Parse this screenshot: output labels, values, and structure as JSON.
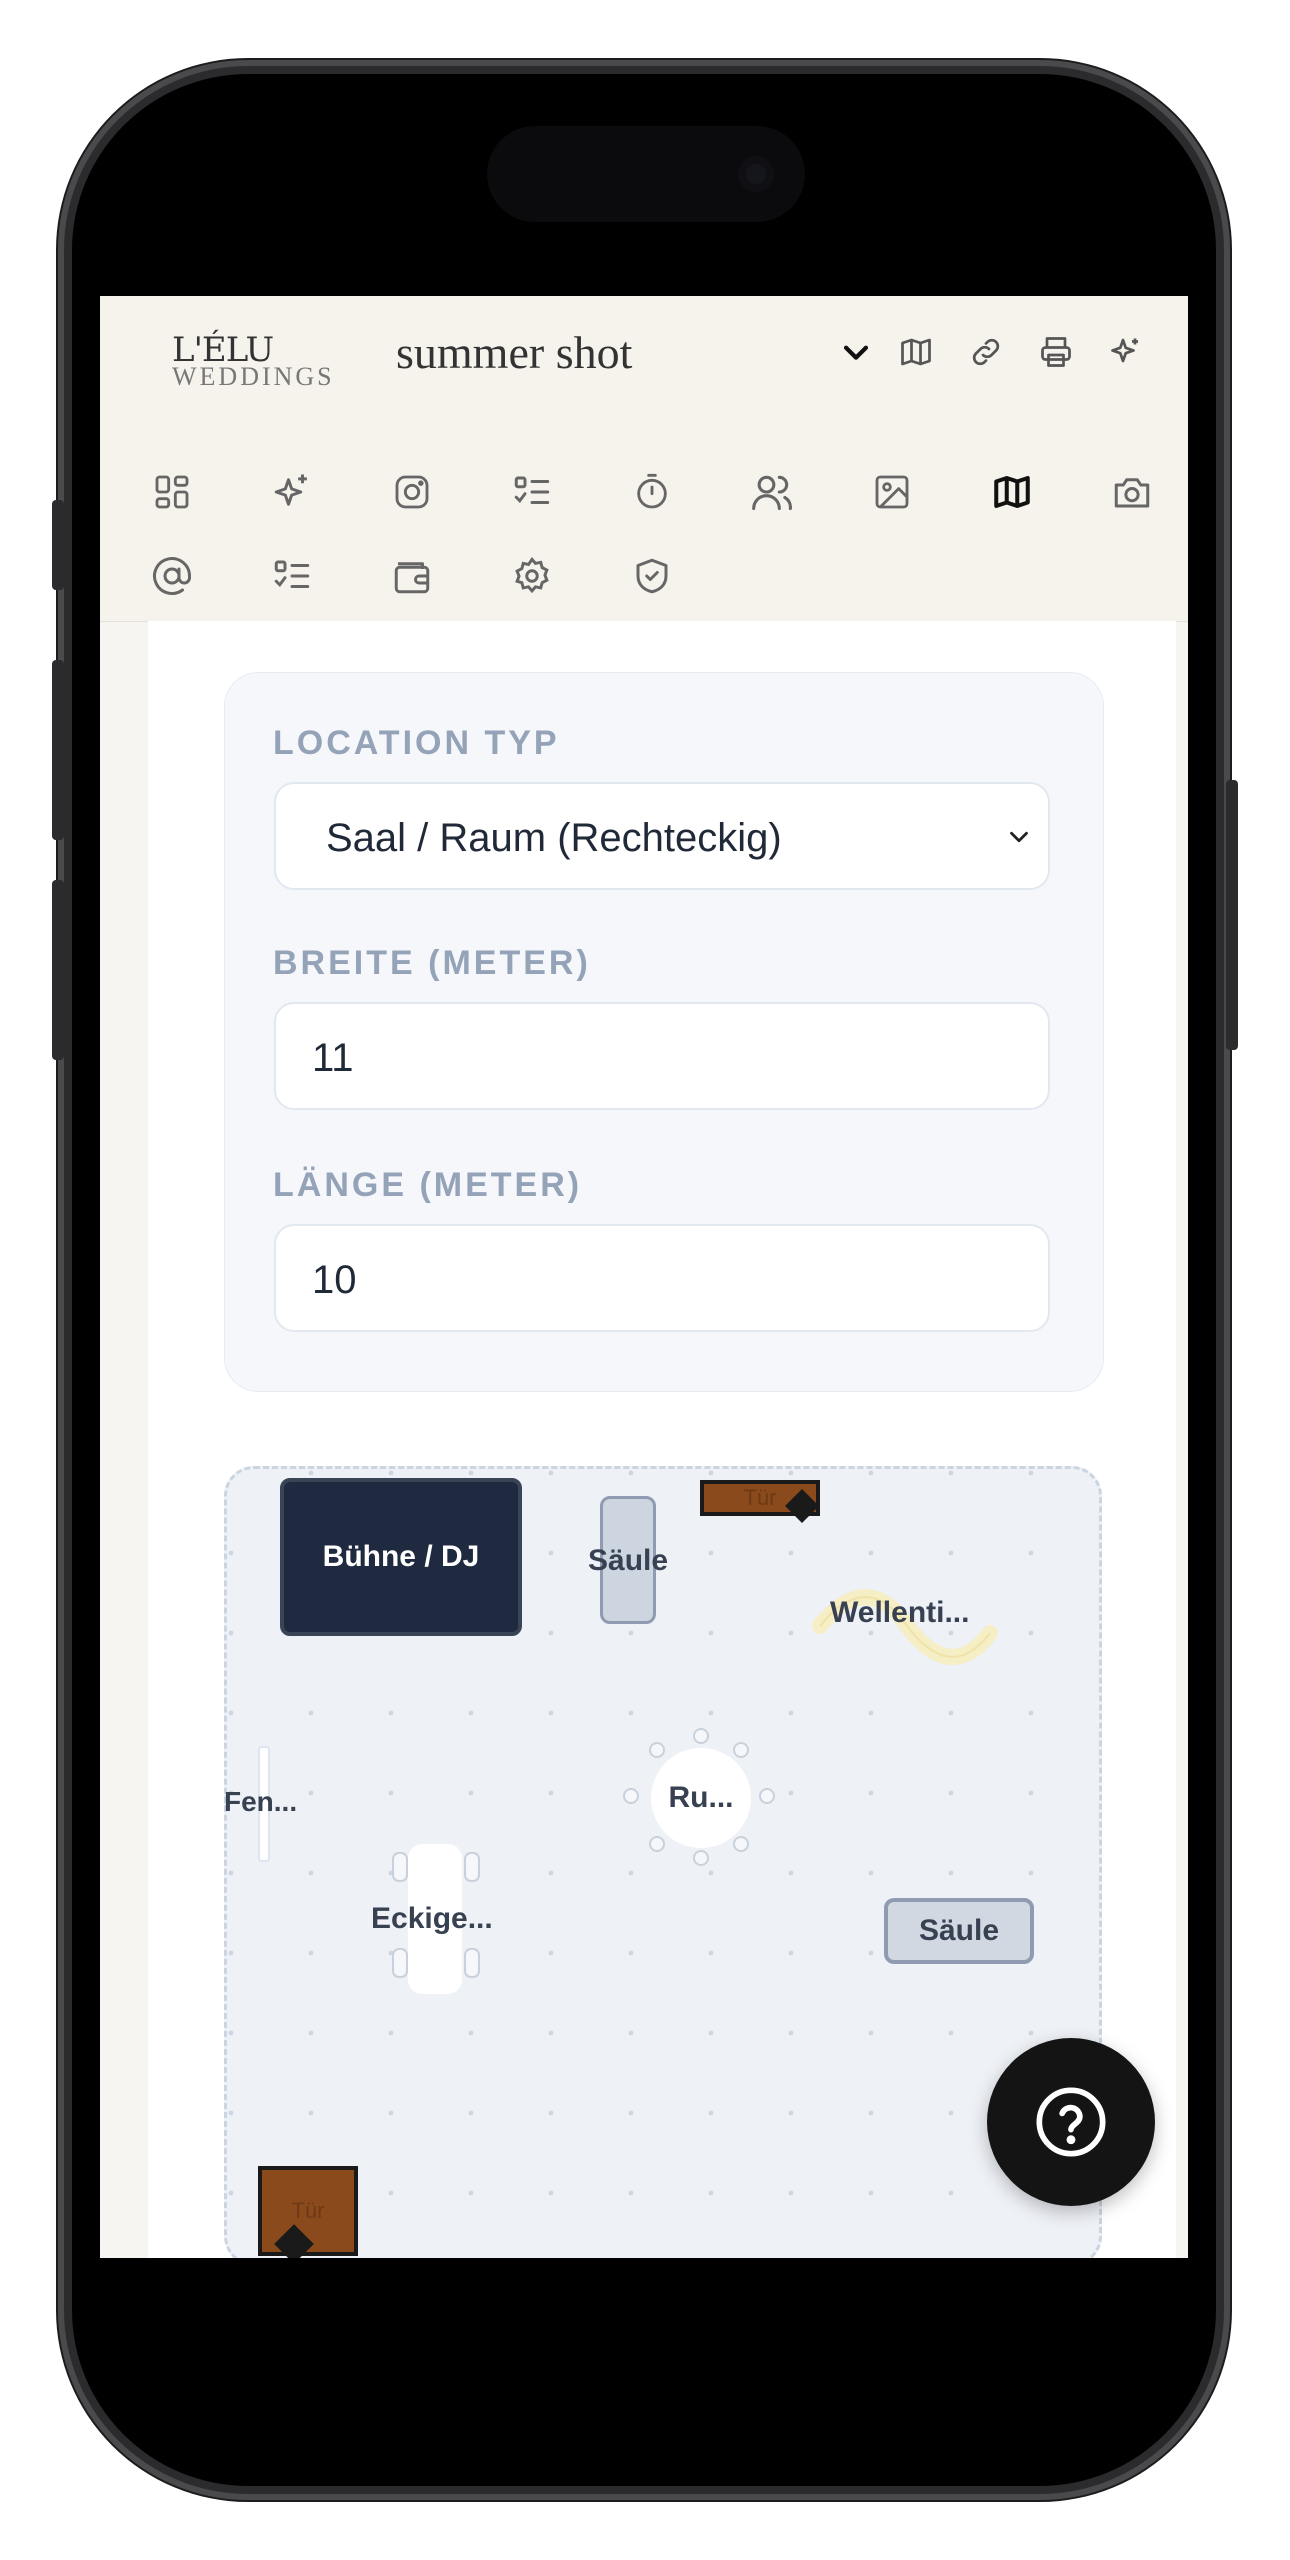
{
  "app": {
    "logo_main": "L'ÉLU",
    "logo_sub": "WEDDINGS",
    "title": "summer shot"
  },
  "header_icons": [
    "chevron-down-icon",
    "map-icon",
    "link-icon",
    "printer-icon",
    "sparkles-icon"
  ],
  "nav_icons": [
    "dashboard-icon",
    "sparkles-icon",
    "instagram-icon",
    "checklist-icon",
    "timer-icon",
    "guests-icon",
    "image-icon",
    "map-icon",
    "camera-icon",
    "at-icon",
    "checklist-icon",
    "wallet-icon",
    "settings-icon",
    "shield-check-icon"
  ],
  "nav_active": "map-icon",
  "form": {
    "location_type_label": "LOCATION TYP",
    "location_type_value": "Saal / Raum (Rechteckig)",
    "width_label": "BREITE (METER)",
    "width_value": "11",
    "length_label": "LÄNGE (METER)",
    "length_value": "10"
  },
  "floorplan": {
    "stage_label": "Bühne / DJ",
    "pillar_1_label": "Säule",
    "door_top_label": "Tür",
    "wave_table_label": "Wellenti...",
    "window_label": "Fen...",
    "round_table_label": "Ru...",
    "rect_table_label": "Eckige...",
    "pillar_2_label": "Säule",
    "door_bottom_label": "Tür"
  },
  "colors": {
    "stage": "#1f2a40",
    "door": "#8b4a1c",
    "pillar": "#cdd5e0",
    "label": "#94a3b8",
    "fab": "#141414"
  }
}
